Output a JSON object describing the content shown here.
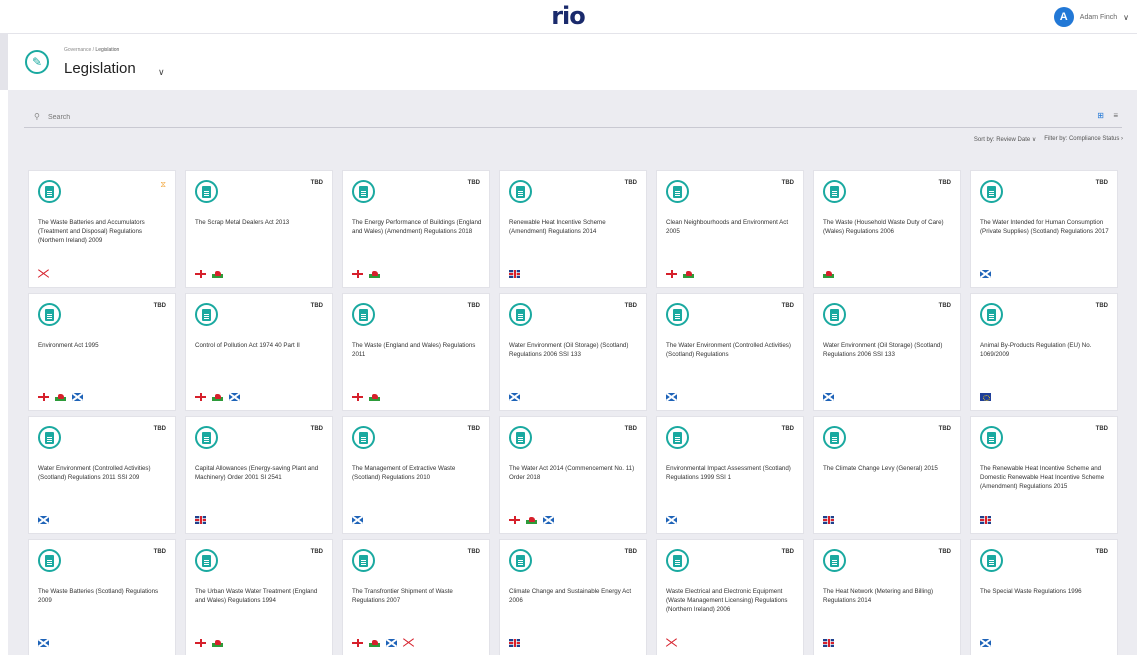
{
  "app": {
    "logo": "rio"
  },
  "user": {
    "initial": "A",
    "name": "Adam Finch",
    "chevron": "∨"
  },
  "header": {
    "breadcrumb_parent": "Governance",
    "breadcrumb_separator": " / ",
    "breadcrumb_current": "Legislation",
    "title": "Legislation",
    "title_chevron": "∨",
    "icon": "pencil-icon"
  },
  "search": {
    "placeholder": "Search",
    "value": ""
  },
  "view": {
    "grid_icon": "⊞",
    "list_icon": "≡"
  },
  "sort": {
    "sort_label": "Sort by: Review Date ∨",
    "filter_label": "Filter by: Compliance Status ›"
  },
  "cards": [
    {
      "status": "⧖",
      "status_type": "warn",
      "title": "The Waste Batteries and Accumulators (Treatment and Disposal) Regulations (Northern Ireland) 2009",
      "flags": [
        "ni"
      ]
    },
    {
      "status": "TBD",
      "title": "The Scrap Metal Dealers Act 2013",
      "flags": [
        "eng",
        "wal"
      ]
    },
    {
      "status": "TBD",
      "title": "The Energy Performance of Buildings (England and Wales) (Amendment) Regulations 2018",
      "flags": [
        "eng",
        "wal"
      ]
    },
    {
      "status": "TBD",
      "title": "Renewable Heat Incentive Scheme (Amendment) Regulations 2014",
      "flags": [
        "uk"
      ]
    },
    {
      "status": "TBD",
      "title": "Clean Neighbourhoods and Environment Act 2005",
      "flags": [
        "eng",
        "wal"
      ]
    },
    {
      "status": "TBD",
      "title": "The Waste (Household Waste Duty of Care) (Wales) Regulations 2006",
      "flags": [
        "wal"
      ]
    },
    {
      "status": "TBD",
      "title": "The Water Intended for Human Consumption (Private Supplies) (Scotland) Regulations 2017",
      "flags": [
        "sco"
      ]
    },
    {
      "status": "TBD",
      "title": "Environment Act 1995",
      "flags": [
        "eng",
        "wal",
        "sco"
      ]
    },
    {
      "status": "TBD",
      "title": "Control of Pollution Act 1974 40 Part II",
      "flags": [
        "eng",
        "wal",
        "sco"
      ]
    },
    {
      "status": "TBD",
      "title": "The Waste (England and Wales) Regulations 2011",
      "flags": [
        "eng",
        "wal"
      ]
    },
    {
      "status": "TBD",
      "title": "Water Environment (Oil Storage) (Scotland) Regulations 2006 SSI 133",
      "flags": [
        "sco"
      ]
    },
    {
      "status": "TBD",
      "title": "The Water Environment (Controlled Activities) (Scotland) Regulations",
      "flags": [
        "sco"
      ]
    },
    {
      "status": "TBD",
      "title": "Water Environment (Oil Storage) (Scotland) Regulations 2006 SSI 133",
      "flags": [
        "sco"
      ]
    },
    {
      "status": "TBD",
      "title": "Animal By-Products Regulation (EU) No. 1069/2009",
      "flags": [
        "eu"
      ]
    },
    {
      "status": "TBD",
      "title": "Water Environment (Controlled Activities) (Scotland) Regulations 2011 SSI 209",
      "flags": [
        "sco"
      ]
    },
    {
      "status": "TBD",
      "title": "Capital Allowances (Energy-saving Plant and Machinery) Order 2001 SI 2541",
      "flags": [
        "uk"
      ]
    },
    {
      "status": "TBD",
      "title": "The Management of Extractive Waste (Scotland) Regulations 2010",
      "flags": [
        "sco"
      ]
    },
    {
      "status": "TBD",
      "title": "The Water Act 2014 (Commencement No. 11) Order 2018",
      "flags": [
        "eng",
        "wal",
        "sco"
      ]
    },
    {
      "status": "TBD",
      "title": "Environmental Impact Assessment (Scotland) Regulations 1999 SSI 1",
      "flags": [
        "sco"
      ]
    },
    {
      "status": "TBD",
      "title": "The Climate Change Levy (General) 2015",
      "flags": [
        "uk"
      ]
    },
    {
      "status": "TBD",
      "title": "The Renewable Heat Incentive Scheme and Domestic Renewable Heat Incentive Scheme (Amendment) Regulations 2015",
      "flags": [
        "uk"
      ]
    },
    {
      "status": "TBD",
      "title": "The Waste Batteries (Scotland) Regulations 2009",
      "flags": [
        "sco"
      ]
    },
    {
      "status": "TBD",
      "title": "The Urban Waste Water Treatment (England and Wales) Regulations 1994",
      "flags": [
        "eng",
        "wal"
      ]
    },
    {
      "status": "TBD",
      "title": "The Transfrontier Shipment of Waste Regulations 2007",
      "flags": [
        "eng",
        "wal",
        "sco",
        "ni"
      ]
    },
    {
      "status": "TBD",
      "title": "Climate Change and Sustainable Energy Act 2006",
      "flags": [
        "uk"
      ]
    },
    {
      "status": "TBD",
      "title": "Waste Electrical and Electronic Equipment (Waste Management Licensing) Regulations (Northern Ireland) 2006",
      "flags": [
        "ni"
      ]
    },
    {
      "status": "TBD",
      "title": "The Heat Network (Metering and Billing) Regulations 2014",
      "flags": [
        "uk"
      ]
    },
    {
      "status": "TBD",
      "title": "The Special Waste Regulations 1996",
      "flags": [
        "sco"
      ]
    }
  ],
  "flag_names": {
    "eng": "england-flag-icon",
    "wal": "wales-flag-icon",
    "sco": "scotland-flag-icon",
    "ni": "northern-ireland-flag-icon",
    "uk": "uk-flag-icon",
    "eu": "eu-flag-icon"
  },
  "colors": {
    "accent": "#1aa9a0",
    "brand": "#1a2a6c",
    "avatar": "#2278d6",
    "warn": "#f2a63b",
    "background": "#ececf1"
  }
}
